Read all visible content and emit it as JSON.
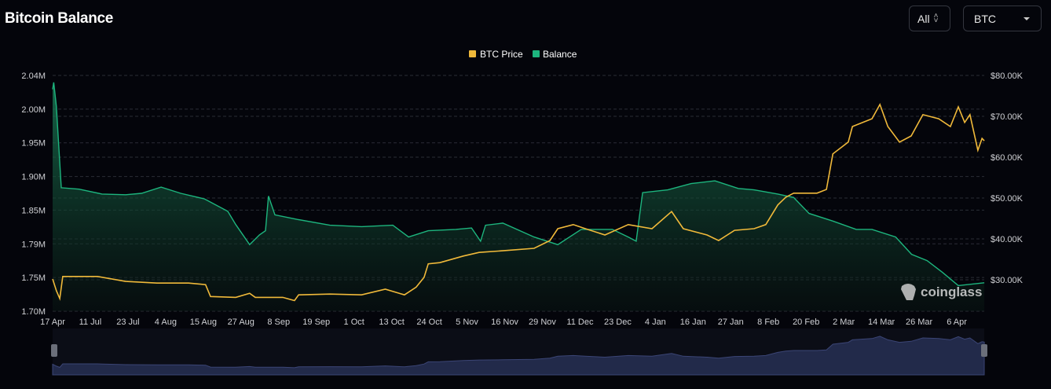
{
  "header": {
    "title": "Bitcoin Balance"
  },
  "controls": {
    "range": "All",
    "coin": "BTC"
  },
  "watermark": "coinglass",
  "colors": {
    "price": "#f0b93a",
    "balance": "#1db57e",
    "navigator": "#3b4575"
  },
  "chart_data": {
    "type": "line",
    "title": "Bitcoin Balance",
    "legend": {
      "position": "top-center",
      "entries": [
        "BTC Price",
        "Balance"
      ]
    },
    "x_ticks": [
      "17 Apr",
      "11 Jul",
      "23 Jul",
      "4 Aug",
      "15 Aug",
      "27 Aug",
      "8 Sep",
      "19 Sep",
      "1 Oct",
      "13 Oct",
      "24 Oct",
      "5 Nov",
      "16 Nov",
      "29 Nov",
      "11 Dec",
      "23 Dec",
      "4 Jan",
      "16 Jan",
      "27 Jan",
      "8 Feb",
      "20 Feb",
      "2 Mar",
      "14 Mar",
      "26 Mar",
      "6 Apr"
    ],
    "y_left": {
      "ticks": [
        "2.04M",
        "2.00M",
        "1.95M",
        "1.90M",
        "1.85M",
        "1.79M",
        "1.75M",
        "1.70M"
      ],
      "range": [
        1.7,
        2.04
      ],
      "unit": "M"
    },
    "y_right": {
      "ticks": [
        "$80.00K",
        "$70.00K",
        "$60.00K",
        "$50.00K",
        "$40.00K",
        "$30.00K"
      ],
      "range": [
        20,
        80
      ],
      "unit": "K USD"
    },
    "grid": true,
    "series": [
      {
        "name": "Balance",
        "axis": "left",
        "type": "area",
        "points": [
          [
            0,
            2.02
          ],
          [
            0.03,
            2.03
          ],
          [
            0.1,
            1.995
          ],
          [
            0.23,
            1.878
          ],
          [
            0.7,
            1.876
          ],
          [
            1.31,
            1.869
          ],
          [
            1.94,
            1.868
          ],
          [
            2.36,
            1.87
          ],
          [
            2.88,
            1.879
          ],
          [
            3.4,
            1.87
          ],
          [
            4.03,
            1.862
          ],
          [
            4.65,
            1.844
          ],
          [
            4.86,
            1.825
          ],
          [
            5.23,
            1.796
          ],
          [
            5.49,
            1.81
          ],
          [
            5.65,
            1.816
          ],
          [
            5.73,
            1.866
          ],
          [
            5.9,
            1.839
          ],
          [
            6.53,
            1.832
          ],
          [
            7.36,
            1.824
          ],
          [
            8.2,
            1.822
          ],
          [
            9.03,
            1.824
          ],
          [
            9.45,
            1.807
          ],
          [
            9.97,
            1.816
          ],
          [
            10.7,
            1.818
          ],
          [
            11.12,
            1.82
          ],
          [
            11.36,
            1.801
          ],
          [
            11.49,
            1.824
          ],
          [
            11.95,
            1.827
          ],
          [
            12.78,
            1.807
          ],
          [
            13.41,
            1.796
          ],
          [
            14.03,
            1.818
          ],
          [
            14.86,
            1.818
          ],
          [
            15.28,
            1.807
          ],
          [
            15.49,
            1.801
          ],
          [
            15.66,
            1.871
          ],
          [
            16.33,
            1.875
          ],
          [
            16.95,
            1.884
          ],
          [
            17.58,
            1.888
          ],
          [
            18.2,
            1.877
          ],
          [
            18.62,
            1.875
          ],
          [
            19.25,
            1.869
          ],
          [
            19.67,
            1.864
          ],
          [
            20.08,
            1.841
          ],
          [
            20.71,
            1.83
          ],
          [
            21.33,
            1.818
          ],
          [
            21.75,
            1.818
          ],
          [
            22.38,
            1.807
          ],
          [
            22.8,
            1.782
          ],
          [
            23.21,
            1.773
          ],
          [
            23.62,
            1.756
          ],
          [
            24.04,
            1.737
          ],
          [
            24.73,
            1.741
          ]
        ]
      },
      {
        "name": "BTC Price",
        "axis": "right",
        "type": "line",
        "points": [
          [
            0,
            30.2
          ],
          [
            0.1,
            27.3
          ],
          [
            0.19,
            25.4
          ],
          [
            0.27,
            30.8
          ],
          [
            0.69,
            30.8
          ],
          [
            1.19,
            30.8
          ],
          [
            1.94,
            29.6
          ],
          [
            2.77,
            29.2
          ],
          [
            3.61,
            29.2
          ],
          [
            4.06,
            28.8
          ],
          [
            4.19,
            25.9
          ],
          [
            4.86,
            25.7
          ],
          [
            5.23,
            26.7
          ],
          [
            5.38,
            25.7
          ],
          [
            6.11,
            25.7
          ],
          [
            6.42,
            24.9
          ],
          [
            6.53,
            26.3
          ],
          [
            7.36,
            26.5
          ],
          [
            8.2,
            26.3
          ],
          [
            8.83,
            27.7
          ],
          [
            9.34,
            26.3
          ],
          [
            9.65,
            28.2
          ],
          [
            9.86,
            30.6
          ],
          [
            9.97,
            33.9
          ],
          [
            10.28,
            34.2
          ],
          [
            10.9,
            35.8
          ],
          [
            11.32,
            36.7
          ],
          [
            11.95,
            37.1
          ],
          [
            12.78,
            37.7
          ],
          [
            13.2,
            39.6
          ],
          [
            13.41,
            42.5
          ],
          [
            13.82,
            43.5
          ],
          [
            14.14,
            42.5
          ],
          [
            14.66,
            40.96
          ],
          [
            15.28,
            43.5
          ],
          [
            15.91,
            42.5
          ],
          [
            16.43,
            46.7
          ],
          [
            16.74,
            42.5
          ],
          [
            17.37,
            40.96
          ],
          [
            17.68,
            39.6
          ],
          [
            18.1,
            42.1
          ],
          [
            18.62,
            42.5
          ],
          [
            18.93,
            43.5
          ],
          [
            19.25,
            48.3
          ],
          [
            19.46,
            50.2
          ],
          [
            19.67,
            51.2
          ],
          [
            20.29,
            51.2
          ],
          [
            20.54,
            52.1
          ],
          [
            20.71,
            60.8
          ],
          [
            21.12,
            63.7
          ],
          [
            21.23,
            67.5
          ],
          [
            21.75,
            69.4
          ],
          [
            21.96,
            72.9
          ],
          [
            22.17,
            67.5
          ],
          [
            22.48,
            63.7
          ],
          [
            22.79,
            65.2
          ],
          [
            23.1,
            70.4
          ],
          [
            23.52,
            69.4
          ],
          [
            23.83,
            67.5
          ],
          [
            24.04,
            72.3
          ],
          [
            24.21,
            68.5
          ],
          [
            24.35,
            70.4
          ],
          [
            24.56,
            61.7
          ],
          [
            24.67,
            64.6
          ],
          [
            24.73,
            64.0
          ]
        ]
      }
    ]
  }
}
